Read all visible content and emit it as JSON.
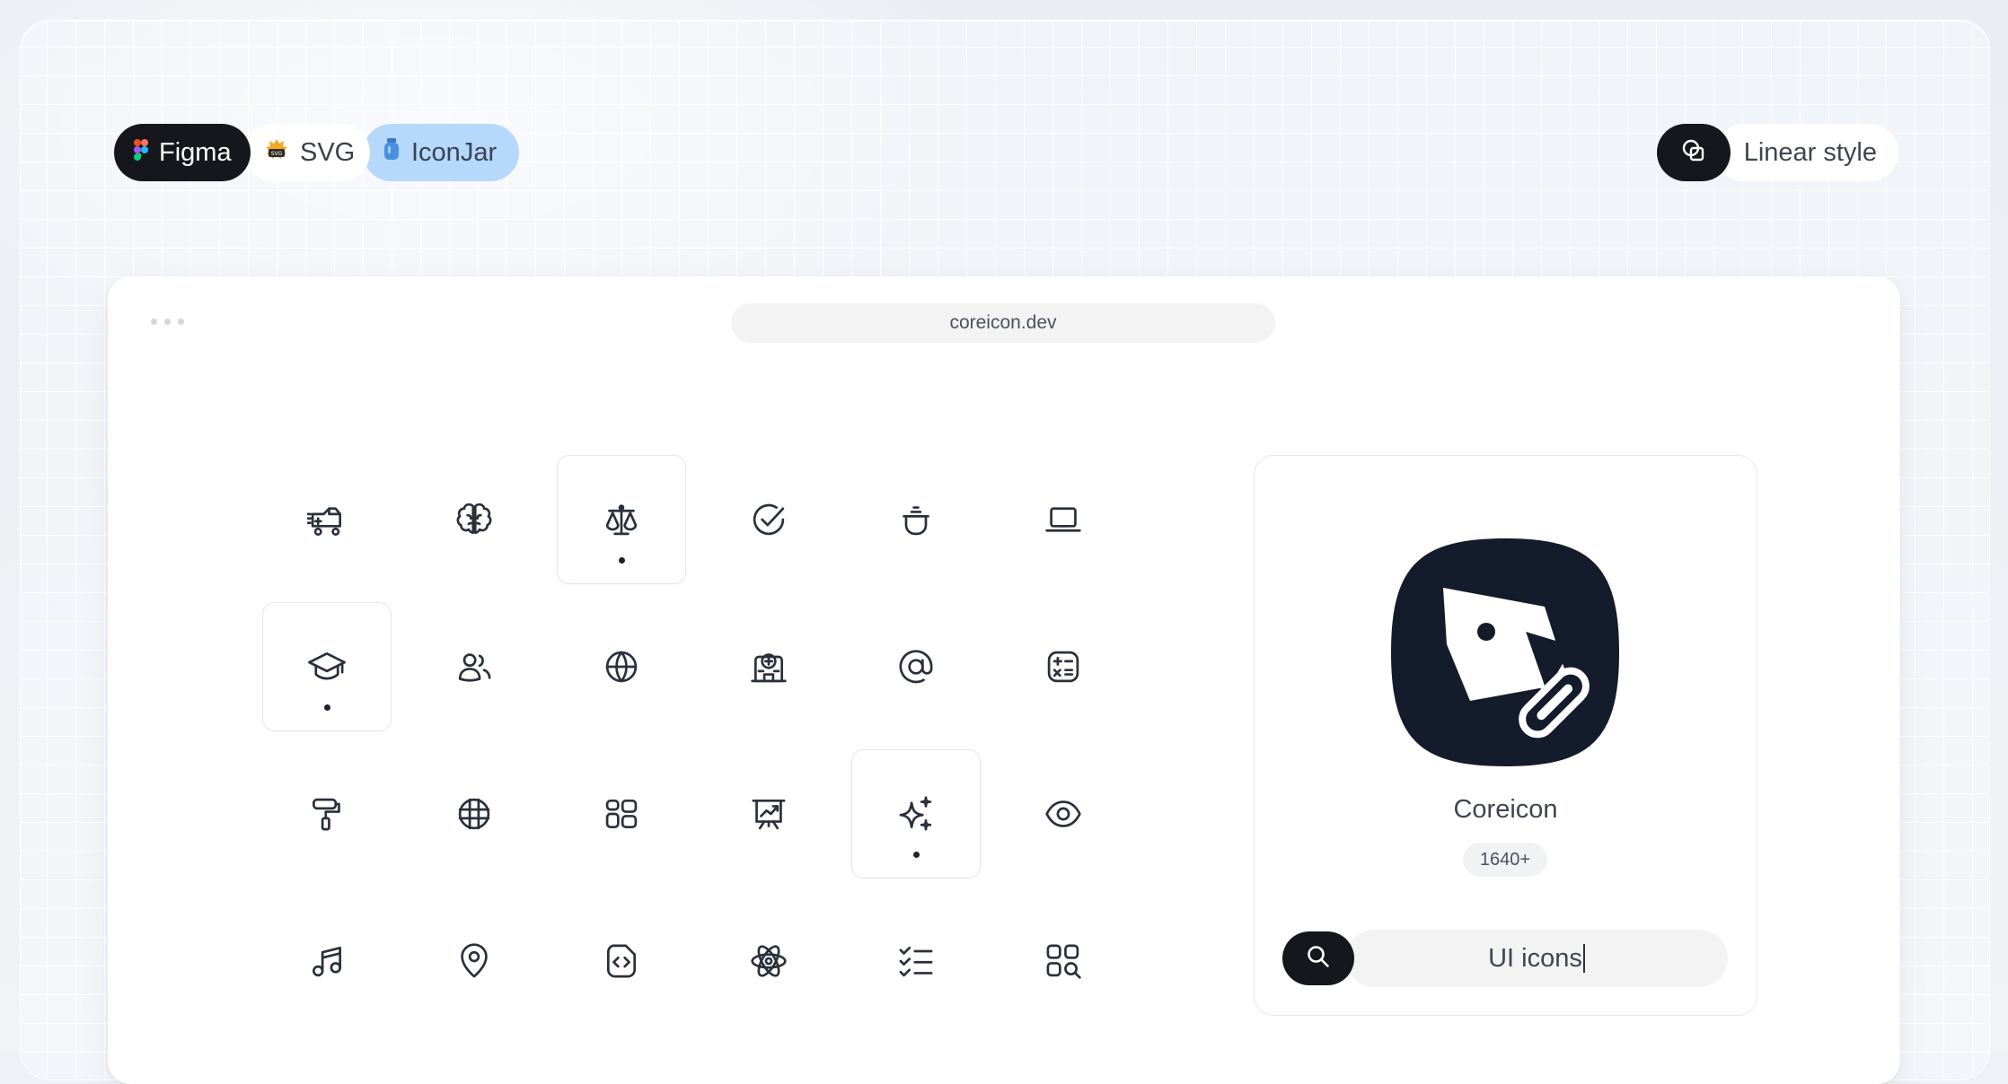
{
  "formats": {
    "figma": {
      "label": "Figma",
      "icon": "figma-logo-icon"
    },
    "svg": {
      "label": "SVG",
      "icon": "svg-badge-icon"
    },
    "iconjar": {
      "label": "IconJar",
      "icon": "iconjar-jar-icon"
    }
  },
  "style_toggle": {
    "icon": "shapes-overlap-icon",
    "label": "Linear style"
  },
  "browser": {
    "url": "coreicon.dev"
  },
  "icon_grid": [
    [
      {
        "icon": "ambulance-icon",
        "selected": false
      },
      {
        "icon": "brain-icon",
        "selected": false
      },
      {
        "icon": "scales-icon",
        "selected": true
      },
      {
        "icon": "check-circle-icon",
        "selected": false
      },
      {
        "icon": "cooking-pot-icon",
        "selected": false
      },
      {
        "icon": "laptop-icon",
        "selected": false
      }
    ],
    [
      {
        "icon": "graduation-cap-icon",
        "selected": true
      },
      {
        "icon": "users-icon",
        "selected": false
      },
      {
        "icon": "globe-icon",
        "selected": false
      },
      {
        "icon": "hospital-icon",
        "selected": false
      },
      {
        "icon": "at-sign-icon",
        "selected": false
      },
      {
        "icon": "calculator-icon",
        "selected": false
      }
    ],
    [
      {
        "icon": "paint-roller-icon",
        "selected": false
      },
      {
        "icon": "grid-sphere-icon",
        "selected": false
      },
      {
        "icon": "dashboard-layout-icon",
        "selected": false
      },
      {
        "icon": "presentation-chart-icon",
        "selected": false
      },
      {
        "icon": "sparkles-icon",
        "selected": true
      },
      {
        "icon": "eye-icon",
        "selected": false
      }
    ],
    [
      {
        "icon": "music-note-icon",
        "selected": false
      },
      {
        "icon": "map-pin-icon",
        "selected": false
      },
      {
        "icon": "code-file-icon",
        "selected": false
      },
      {
        "icon": "atom-icon",
        "selected": false
      },
      {
        "icon": "checklist-icon",
        "selected": false
      },
      {
        "icon": "grid-search-icon",
        "selected": false
      }
    ]
  ],
  "product": {
    "logo": "coreicon-logo-icon",
    "name": "Coreicon",
    "count": "1640+",
    "search_value": "UI icons",
    "search_icon": "search-icon"
  },
  "colors": {
    "accent_dark": "#15171c",
    "iconjar_bg": "#b5d8fb",
    "logo_bg": "#141c2b"
  }
}
